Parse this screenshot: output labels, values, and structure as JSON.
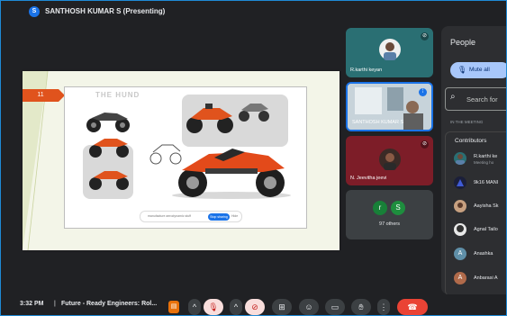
{
  "presenter": {
    "initial": "S",
    "label": "SANTHOSH KUMAR S (Presenting)"
  },
  "slide": {
    "number": "11",
    "art_title": "THE HUND",
    "search_text": "manufacture aerodynamic stuff",
    "search_button": "Stop sharing",
    "search_extra": "Hide"
  },
  "tiles": [
    {
      "name": "R.karthi keyan",
      "bg": "#2a6f73"
    },
    {
      "name": "SANTHOSH KUMAR S",
      "bg": "#b9c7cf"
    },
    {
      "name": "N. Jeevitha jeevi",
      "bg": "#7d1d28"
    },
    {
      "name": "97 others",
      "avatars": [
        "r",
        "S"
      ],
      "bg": "#3c4043"
    }
  ],
  "people_panel": {
    "title": "People",
    "mute_all": "Mute all",
    "search_placeholder": "Search for",
    "section": "IN THE MEETING",
    "contributors_label": "Contributors",
    "participants": [
      {
        "name": "R.karthi ke",
        "sub": "Meeting ho"
      },
      {
        "name": "9k16 MANI"
      },
      {
        "name": "Aayisha Sk"
      },
      {
        "name": "Agnal Tailo"
      },
      {
        "name": "Anashka",
        "initial": "A"
      },
      {
        "name": "Anbarasi A",
        "initial": "A"
      }
    ]
  },
  "bottom_bar": {
    "time": "3:32 PM",
    "separator": "|",
    "meeting_title": "Future - Ready Engineers: Rol..."
  },
  "icons": [
    "mic-off-icon",
    "camera-off-icon",
    "present-icon",
    "emoji-icon",
    "captions-icon",
    "raise-hand-icon",
    "more-icon",
    "end-call-icon",
    "search-icon",
    "chevron-up-icon"
  ],
  "colors": {
    "accent": "#1a73e8",
    "end_call": "#ea4335",
    "slide_accent": "#e0531d",
    "mute_all": "#a8c7fa"
  }
}
